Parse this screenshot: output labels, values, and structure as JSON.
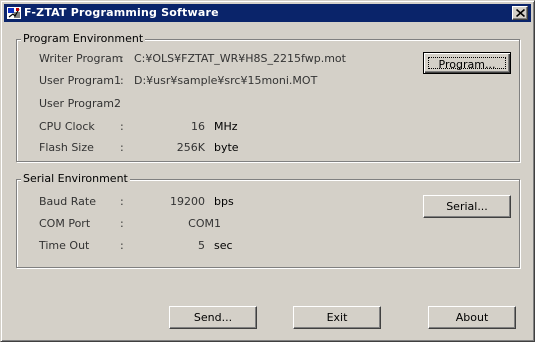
{
  "window": {
    "title": "F-ZTAT Programming Software"
  },
  "program_env": {
    "legend": "Program Environment",
    "rows": [
      {
        "label": "Writer Program",
        "colon": ":",
        "value": "C:¥OLS¥FZTAT_WR¥H8S_2215fwp.mot",
        "unit": ""
      },
      {
        "label": "User Program1",
        "colon": ":",
        "value": "D:¥usr¥sample¥src¥15moni.MOT",
        "unit": ""
      },
      {
        "label": "User Program2",
        "colon": ":",
        "value": "",
        "unit": ""
      },
      {
        "label": "CPU Clock",
        "colon": ":",
        "value": "16",
        "unit": "MHz"
      },
      {
        "label": "Flash Size",
        "colon": ":",
        "value": "256K",
        "unit": "byte"
      }
    ],
    "program_button": "Program..."
  },
  "serial_env": {
    "legend": "Serial Environment",
    "rows": [
      {
        "label": "Baud Rate",
        "colon": ":",
        "value": "19200",
        "unit": "bps"
      },
      {
        "label": "COM Port",
        "colon": ":",
        "value": "COM1",
        "unit": ""
      },
      {
        "label": "Time Out",
        "colon": ":",
        "value": "5",
        "unit": "sec"
      }
    ],
    "serial_button": "Serial..."
  },
  "bottom_buttons": {
    "send": "Send...",
    "exit": "Exit",
    "about": "About"
  },
  "colors": {
    "titlebar": "#0a246a",
    "face": "#d4d0c8"
  },
  "icons": {
    "app": "app-icon",
    "close": "close-icon"
  }
}
